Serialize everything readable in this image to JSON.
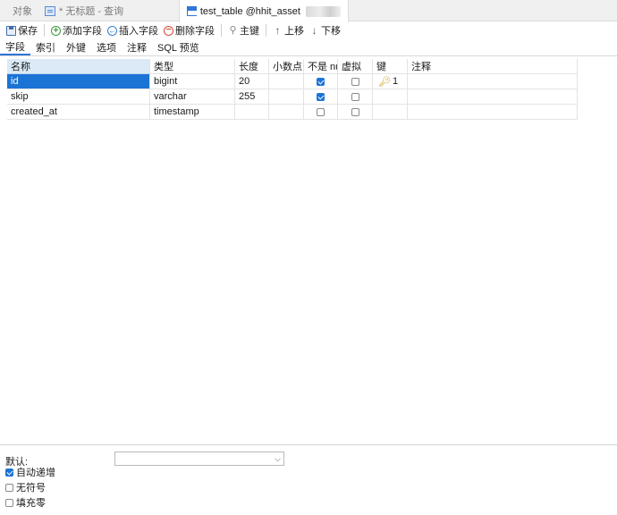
{
  "tabs": [
    {
      "label": "对象"
    },
    {
      "label": "* 无标题 - 查询"
    },
    {
      "label": "test_table @hhit_asset"
    }
  ],
  "toolbar": {
    "save": "保存",
    "add_field": "添加字段",
    "insert_field": "插入字段",
    "delete_field": "删除字段",
    "primary_key": "主键",
    "move_up": "上移",
    "move_down": "下移"
  },
  "subtabs": [
    "字段",
    "索引",
    "外键",
    "选项",
    "注释",
    "SQL 预览"
  ],
  "columns": [
    "名称",
    "类型",
    "长度",
    "小数点",
    "不是 null",
    "虚拟",
    "键",
    "注释"
  ],
  "rows": [
    {
      "name": "id",
      "type": "bigint",
      "length": "20",
      "decimals": "",
      "not_null": true,
      "virtual": false,
      "key": "1",
      "comment": ""
    },
    {
      "name": "skip",
      "type": "varchar",
      "length": "255",
      "decimals": "",
      "not_null": true,
      "virtual": false,
      "key": "",
      "comment": ""
    },
    {
      "name": "created_at",
      "type": "timestamp",
      "length": "",
      "decimals": "",
      "not_null": false,
      "virtual": false,
      "key": "",
      "comment": ""
    }
  ],
  "bottom": {
    "default_label": "默认:",
    "default_value": "",
    "auto_increment": {
      "label": "自动递增",
      "checked": true
    },
    "unsigned": {
      "label": "无符号",
      "checked": false
    },
    "zerofill": {
      "label": "填充零",
      "checked": false
    }
  },
  "colors": {
    "accent": "#1c73d6",
    "header_selected": "#dceaf7"
  }
}
